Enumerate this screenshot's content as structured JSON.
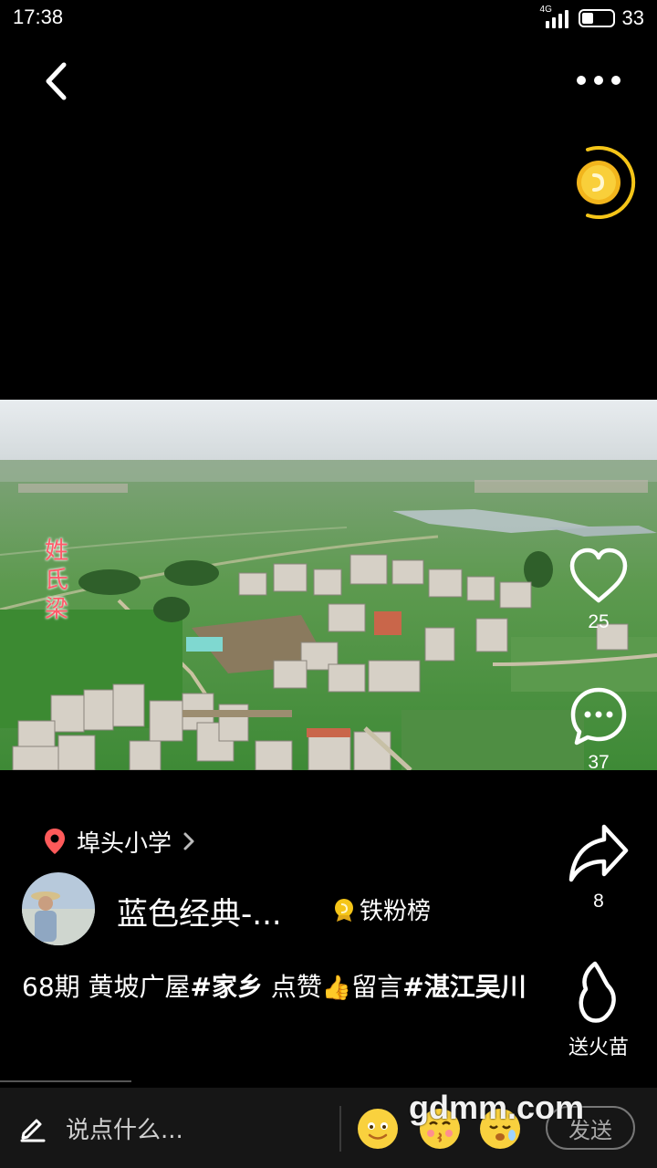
{
  "status_bar": {
    "time": "17:38",
    "network": "4G",
    "battery": "33"
  },
  "video": {
    "overlay_chars": [
      "姓",
      "氏",
      "梁"
    ]
  },
  "actions": {
    "like": {
      "count": "25",
      "icon": "heart-icon"
    },
    "comment": {
      "count": "37",
      "icon": "speech-bubble-icon"
    },
    "share": {
      "count": "8",
      "icon": "share-arrow-icon"
    },
    "fire": {
      "label": "送火苗",
      "icon": "flame-icon"
    }
  },
  "location": {
    "label": "埠头小学"
  },
  "author": {
    "name": "蓝色经典-...",
    "badge": "铁粉榜"
  },
  "caption": {
    "prefix": " 68期 黄坡广屋",
    "tag1": "#家乡",
    "middle": " 点赞",
    "thumb": "👍",
    "after": "留言",
    "tag2": "#湛江吴川"
  },
  "input_bar": {
    "placeholder": "说点什么...",
    "send_label": "发送"
  },
  "watermark": "gdmm.com",
  "colors": {
    "coin": "#f5c518",
    "location_pin": "#ff5a5a",
    "overlay_text": "#ff5a6a"
  }
}
